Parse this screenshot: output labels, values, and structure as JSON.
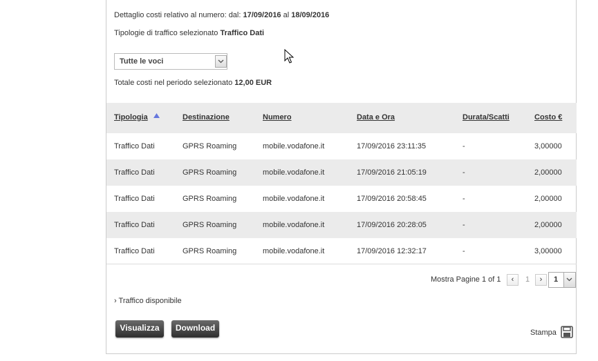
{
  "header": {
    "detail_prefix": "Dettaglio costi relativo al numero: dal:",
    "date_from": "17/09/2016",
    "date_sep": "al",
    "date_to": "18/09/2016",
    "traffic_prefix": "Tipologie di traffico selezionato",
    "traffic_type": "Traffico Dati",
    "filter_value": "Tutte le voci",
    "total_prefix": "Totale costi nel periodo selezionato",
    "total_value": "12,00 EUR"
  },
  "table": {
    "columns": [
      "Tipologia",
      "Destinazione",
      "Numero",
      "Data e Ora",
      "Durata/Scatti",
      "Costo €"
    ],
    "rows": [
      [
        "Traffico Dati",
        "GPRS Roaming",
        "mobile.vodafone.it",
        "17/09/2016 23:11:35",
        "-",
        "3,00000"
      ],
      [
        "Traffico Dati",
        "GPRS Roaming",
        "mobile.vodafone.it",
        "17/09/2016 21:05:19",
        "-",
        "2,00000"
      ],
      [
        "Traffico Dati",
        "GPRS Roaming",
        "mobile.vodafone.it",
        "17/09/2016 20:58:45",
        "-",
        "2,00000"
      ],
      [
        "Traffico Dati",
        "GPRS Roaming",
        "mobile.vodafone.it",
        "17/09/2016 20:28:05",
        "-",
        "2,00000"
      ],
      [
        "Traffico Dati",
        "GPRS Roaming",
        "mobile.vodafone.it",
        "17/09/2016 12:32:17",
        "-",
        "3,00000"
      ]
    ]
  },
  "pager": {
    "label": "Mostra Pagine 1 of 1",
    "prev": "‹",
    "current": "1",
    "next": "›",
    "select_value": "1"
  },
  "traffic_link": "Traffico disponibile",
  "buttons": {
    "view": "Visualizza",
    "download": "Download",
    "print": "Stampa"
  },
  "icons": {
    "sort": "sort-ascending-icon",
    "dropdown": "chevron-down-icon",
    "print": "printer-icon",
    "cursor": "mouse-pointer-icon"
  },
  "colors": {
    "button_dark": "#3a3a3a",
    "row_alt": "#ebebeb",
    "sort_arrow": "#6677dd"
  }
}
